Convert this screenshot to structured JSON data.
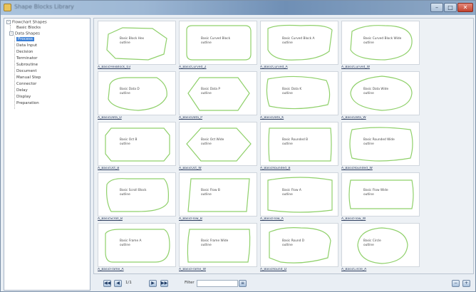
{
  "window": {
    "title": "Shape Blocks Library"
  },
  "tree": {
    "root": "Flowchart Shapes",
    "root_child": "Basic Blocks",
    "group": "Data Shapes",
    "items": [
      "Process",
      "Data Input",
      "Decision",
      "Terminator",
      "Subroutine",
      "Document",
      "Manual Step",
      "Connector",
      "Delay",
      "Display",
      "Preparation"
    ]
  },
  "thumbnails": [
    {
      "text": [
        "Basic Block Hex",
        "outline"
      ],
      "caption": "A_BasicHexBlock_03"
    },
    {
      "text": [
        "Basic Curved Block",
        "outline"
      ],
      "caption": "A_BasicCurved_2"
    },
    {
      "text": [
        "Basic Curved Block A",
        "outline"
      ],
      "caption": "A_BasicCurved_A"
    },
    {
      "text": [
        "Basic Curved Block Wide",
        "outline"
      ],
      "caption": "A_BasicCurved_W"
    },
    {
      "text": [
        "Basic Data D",
        "outline"
      ],
      "caption": "A_BasicData_D"
    },
    {
      "text": [
        "Basic Data P",
        "outline"
      ],
      "caption": "A_BasicData_P"
    },
    {
      "text": [
        "Basic Data K",
        "outline"
      ],
      "caption": "A_BasicData_K"
    },
    {
      "text": [
        "Basic Data Wide",
        "outline"
      ],
      "caption": "A_BasicData_W"
    },
    {
      "text": [
        "Basic Oct B",
        "outline"
      ],
      "caption": "A_BasicOct_B"
    },
    {
      "text": [
        "Basic Oct Wide",
        "outline"
      ],
      "caption": "A_BasicOct_W"
    },
    {
      "text": [
        "Basic Rounded B",
        "outline"
      ],
      "caption": "A_BasicRounded_B"
    },
    {
      "text": [
        "Basic Rounded Wide",
        "outline"
      ],
      "caption": "A_BasicRounded_W"
    },
    {
      "text": [
        "Basic Scroll Block",
        "outline"
      ],
      "caption": "A_BasicScroll_B"
    },
    {
      "text": [
        "Basic Flow B",
        "outline"
      ],
      "caption": "A_BasicFlow_B"
    },
    {
      "text": [
        "Basic Flow A",
        "outline"
      ],
      "caption": "A_BasicFlow_A"
    },
    {
      "text": [
        "Basic Flow Wide",
        "outline"
      ],
      "caption": "A_BasicFlow_W"
    },
    {
      "text": [
        "Basic Frame A",
        "outline"
      ],
      "caption": "A_BasicFrame_A"
    },
    {
      "text": [
        "Basic Frame Wide",
        "outline"
      ],
      "caption": "A_BasicFrame_W"
    },
    {
      "text": [
        "Basic Round D",
        "outline"
      ],
      "caption": "A_BasicRound_D"
    },
    {
      "text": [
        "Basic Circle",
        "outline"
      ],
      "caption": "A_BasicCircle_A"
    }
  ],
  "footer": {
    "page_text": "1/1",
    "filter_label": "Filter",
    "filter_value": ""
  },
  "colors": {
    "outline": "#8fd06a",
    "selection": "#3a7fd6"
  }
}
